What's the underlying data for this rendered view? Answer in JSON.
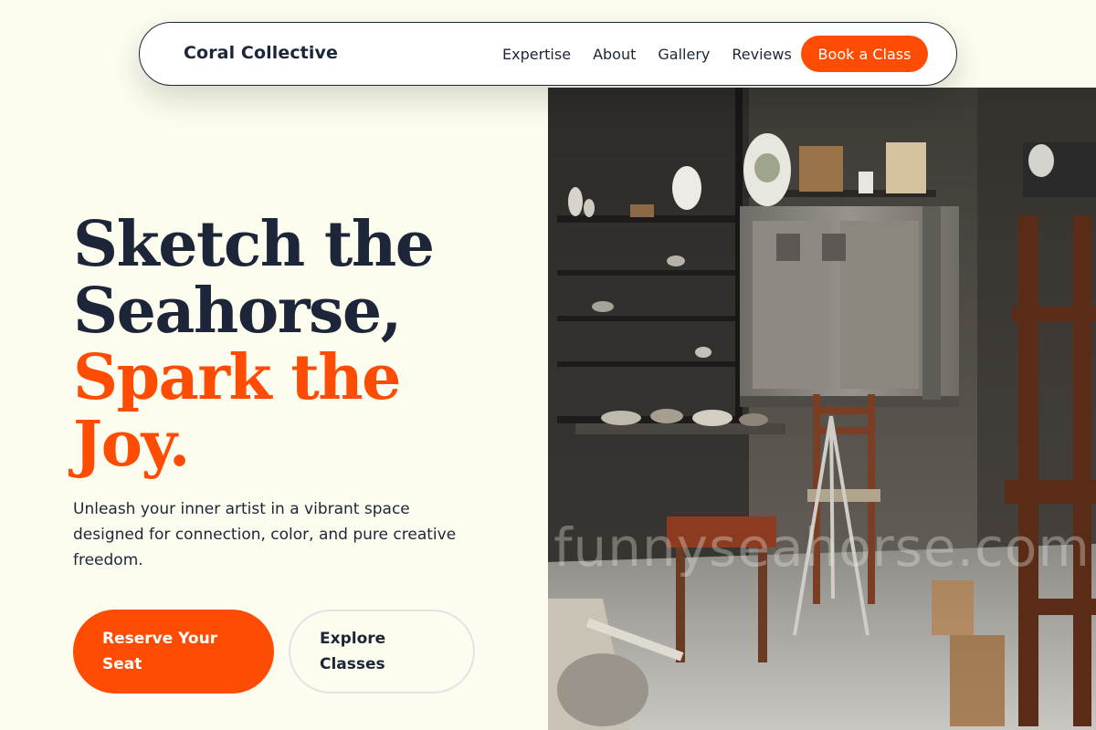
{
  "navbar": {
    "brand": "Coral Collective",
    "links": [
      "Expertise",
      "About",
      "Gallery",
      "Reviews"
    ],
    "cta_label": "Book a Class"
  },
  "hero": {
    "headline_dark": [
      "Sketch the",
      "Seahorse,"
    ],
    "headline_accent": [
      "Spark the",
      "Joy."
    ],
    "subtitle": "Unleash your inner artist in a vibrant space designed for connection, color, and pure creative freedom.",
    "primary_button": "Reserve Your Seat",
    "secondary_button": "Explore Classes",
    "image_watermark": "funnyseahorse.com"
  },
  "colors": {
    "accent": "#ff4c05",
    "text": "#1c2638",
    "background": "#fdfdef"
  }
}
